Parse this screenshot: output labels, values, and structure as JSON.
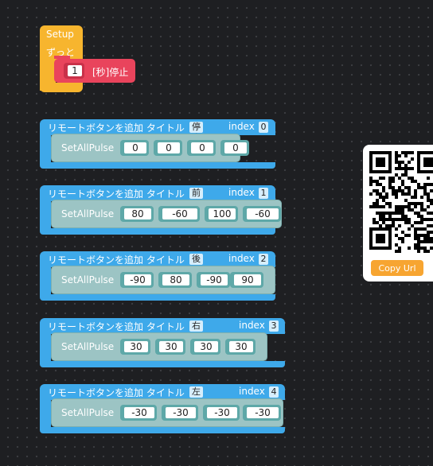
{
  "setup": {
    "title": "Setup",
    "forever_label": "ずっと",
    "wait_value": "1",
    "wait_label": "[秒]停止"
  },
  "remote_buttons": [
    {
      "title_text": "リモートボタンを追加 タイトル",
      "label": "停止",
      "index_label": "index",
      "index": "0",
      "block_label": "SetAllPulse",
      "values": [
        "0",
        "0",
        "0",
        "0"
      ]
    },
    {
      "title_text": "リモートボタンを追加 タイトル",
      "label": "前進",
      "index_label": "index",
      "index": "1",
      "block_label": "SetAllPulse",
      "values": [
        "80",
        "-60",
        "100",
        "-60"
      ]
    },
    {
      "title_text": "リモートボタンを追加 タイトル",
      "label": "後退",
      "index_label": "index",
      "index": "2",
      "block_label": "SetAllPulse",
      "values": [
        "-90",
        "80",
        "-90",
        "90"
      ]
    },
    {
      "title_text": "リモートボタンを追加 タイトル",
      "label": "右回転",
      "index_label": "index",
      "index": "3",
      "block_label": "SetAllPulse",
      "values": [
        "30",
        "30",
        "30",
        "30"
      ]
    },
    {
      "title_text": "リモートボタンを追加 タイトル",
      "label": "左回転",
      "index_label": "index",
      "index": "4",
      "block_label": "SetAllPulse",
      "values": [
        "-30",
        "-30",
        "-30",
        "-30"
      ]
    }
  ],
  "qr_panel": {
    "copy_button": "Copy Url"
  },
  "colors": {
    "setup_block": "#f7b52e",
    "wait_block": "#e9445c",
    "remote_block": "#3ea9ea",
    "pulse_block": "#9cc4c4",
    "copy_button": "#f7a531"
  }
}
